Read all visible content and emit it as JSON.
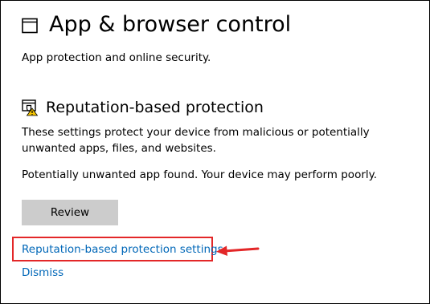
{
  "header": {
    "title": "App & browser control",
    "subtitle": "App protection and online security.",
    "icon": "app-window-icon"
  },
  "reputation": {
    "title": "Reputation-based protection",
    "icon": "shield-warning-icon",
    "description": "These settings protect your device from malicious or potentially unwanted apps, files, and websites.",
    "warning": "Potentially unwanted app found. Your device may perform poorly.",
    "review_label": "Review",
    "settings_link": "Reputation-based protection settings",
    "dismiss_link": "Dismiss"
  },
  "colors": {
    "link": "#0067b8",
    "button_bg": "#cccccc",
    "annotation": "#e32728",
    "warning_badge": "#f5c400"
  }
}
